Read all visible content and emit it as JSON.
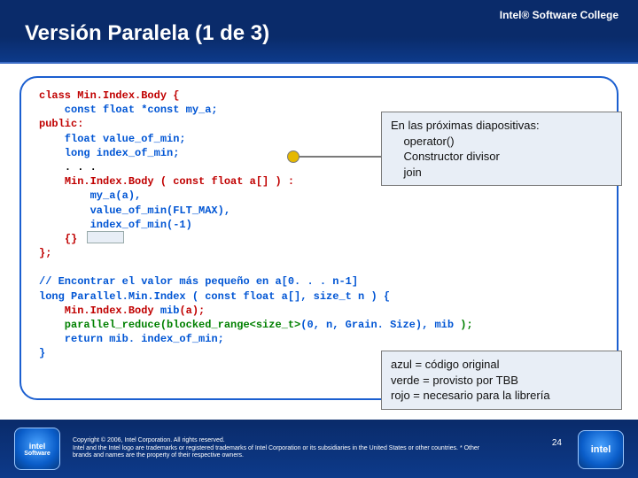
{
  "header": {
    "college": "Intel® Software College",
    "title": "Versión Paralela (1 de 3)"
  },
  "code1": {
    "l1": "class Min.Index.Body {",
    "l2": "    const float *const my_a;",
    "l3": "public:",
    "l4": "    float value_of_min;",
    "l5": "    long index_of_min;",
    "l6a": "    ",
    "l6b": ". . .",
    "l7a": "    ",
    "l7b": "Min.Index.Body ( const float a[] ) :",
    "l8a": "        ",
    "l8b": "my_a(a),",
    "l9a": "        ",
    "l9b": "value_of_min(FLT_MAX),",
    "l10a": "        ",
    "l10b": "index_of_min(-1)",
    "l11a": "    ",
    "l11b": "{}",
    "l12": "};"
  },
  "code2": {
    "l1": "// Encontrar el valor más pequeño en a[0. . . n-1]",
    "l2": "long Parallel.Min.Index ( const float a[], size_t n ) {",
    "l3a": "    Min.Index.Body ",
    "l3b": "mib",
    "l3c": "(a);",
    "l4a": "    parallel_reduce(blocked_range<size_t>",
    "l4b": "(0, n, Grain. Size), ",
    "l4c": "mib",
    "l4d": " );",
    "l5a": "    return ",
    "l5b": "mib. index_of_min;",
    "l6": "}"
  },
  "callout1": {
    "l1": "En las próximas diapositivas:",
    "l2": "    operator()",
    "l3": "    Constructor divisor",
    "l4": "    join"
  },
  "callout2": {
    "l1": "azul = código original",
    "l2": "verde = provisto por TBB",
    "l3": "rojo = necesario para la librería"
  },
  "footer": {
    "copyright": "Copyright © 2006, Intel Corporation. All rights reserved.",
    "legal": "Intel and the Intel logo are trademarks or registered trademarks of Intel Corporation or its subsidiaries in the United States or other countries. * Other brands and names are the property of their respective owners.",
    "page": "24",
    "badge_left_top": "intel",
    "badge_left_bottom": "Software",
    "badge_right": "intel"
  }
}
